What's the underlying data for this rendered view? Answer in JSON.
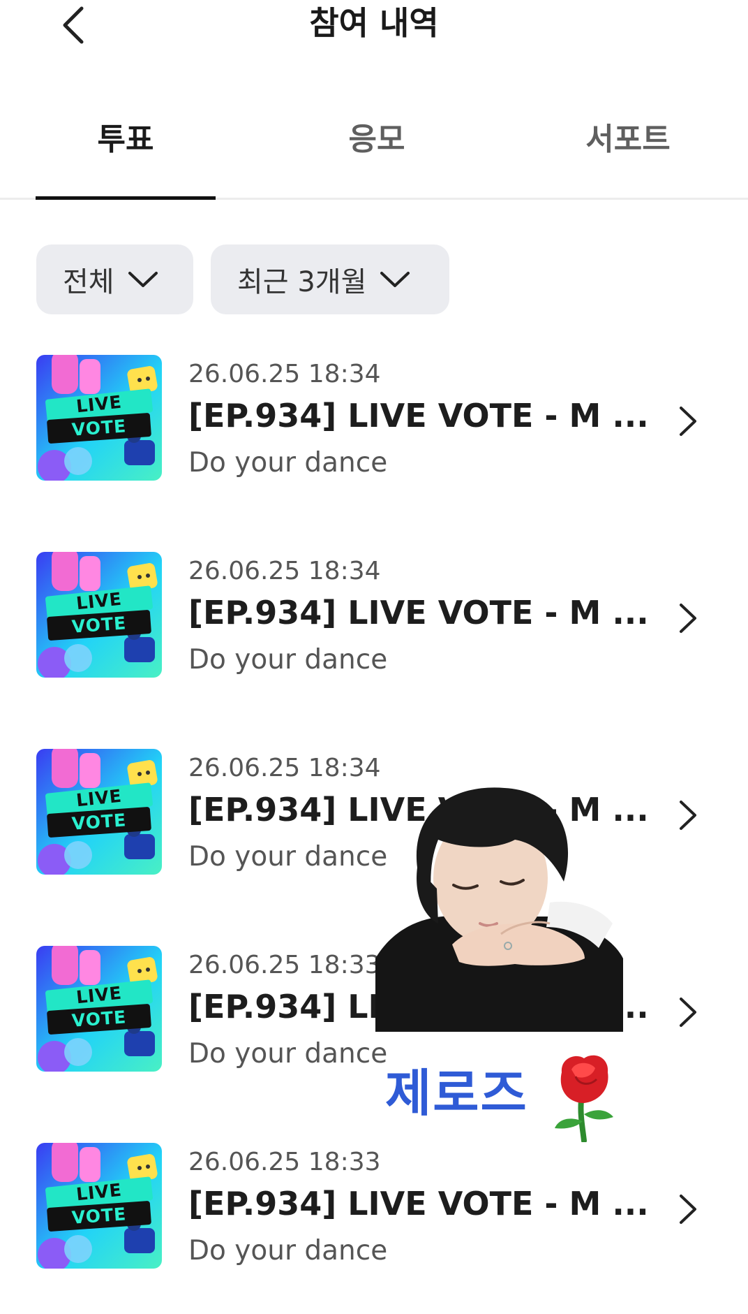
{
  "header": {
    "title": "참여 내역",
    "back_icon": "chevron-left-icon"
  },
  "tabs": [
    {
      "label": "투표",
      "active": true
    },
    {
      "label": "응모",
      "active": false
    },
    {
      "label": "서포트",
      "active": false
    }
  ],
  "filters": {
    "category": "전체",
    "period": "최근 3개월"
  },
  "items": [
    {
      "date": "26.06.25 18:34",
      "title": "[EP.934] LIVE VOTE - M ...",
      "subtitle": "Do your dance",
      "thumb_top": "LIVE",
      "thumb_bottom": "VOTE"
    },
    {
      "date": "26.06.25 18:34",
      "title": "[EP.934] LIVE VOTE - M ...",
      "subtitle": "Do your dance",
      "thumb_top": "LIVE",
      "thumb_bottom": "VOTE"
    },
    {
      "date": "26.06.25 18:34",
      "title": "[EP.934] LIVE VOTE - M ...",
      "subtitle": "Do your dance",
      "thumb_top": "LIVE",
      "thumb_bottom": "VOTE"
    },
    {
      "date": "26.06.25 18:33",
      "title": "[EP.934] LIVE VOTE - M ...",
      "subtitle": "Do your dance",
      "thumb_top": "LIVE",
      "thumb_bottom": "VOTE"
    },
    {
      "date": "26.06.25 18:33",
      "title": "[EP.934] LIVE VOTE - M ...",
      "subtitle": "Do your dance",
      "thumb_top": "LIVE",
      "thumb_bottom": "VOTE"
    }
  ],
  "sticker": {
    "caption": "제로즈"
  },
  "colors": {
    "accent_active": "#111111",
    "filter_bg": "#ebecf0",
    "sticker_text": "#2f5bd6"
  }
}
